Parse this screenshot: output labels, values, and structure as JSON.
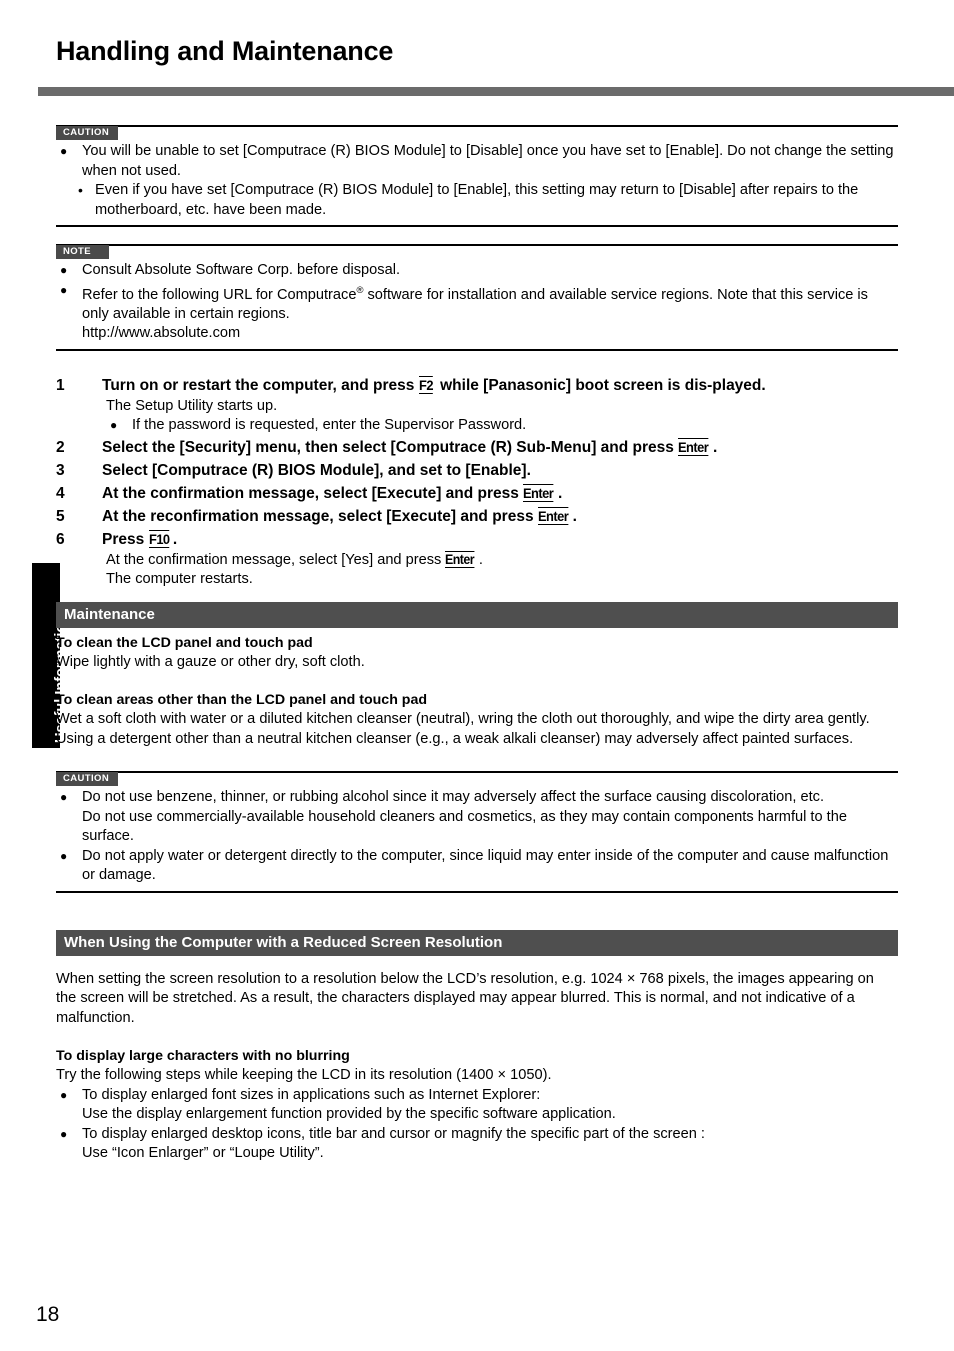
{
  "document": {
    "title": "Handling and Maintenance",
    "page_number": "18",
    "side_tab_label": "Useful Information"
  },
  "caution1": {
    "tag": "CAUTION",
    "bullets": [
      "You will be unable to set [Computrace (R) BIOS Module] to [Disable] once you have set to [Enable]. Do not change the setting when not used."
    ],
    "subbullets": [
      "Even if you have set [Computrace (R) BIOS Module] to [Enable], this setting may return to [Disable] after repairs to the motherboard, etc. have been made."
    ]
  },
  "note1": {
    "tag": "NOTE",
    "bullet1": "Consult Absolute Software Corp. before disposal.",
    "bullet2_part1": "Refer to the following URL for Computrace",
    "bullet2_reg": "®",
    "bullet2_part2": " software for installation and available service regions. Note that this service is only available in certain regions.",
    "bullet2_url": "http://www.absolute.com"
  },
  "steps": [
    {
      "num": "1",
      "head_part1": "Turn on or restart the computer, and press ",
      "key": "F2",
      "head_part2": " while [Panasonic] boot screen is dis-played.",
      "detail_line": "The Setup Utility starts up.",
      "detail_bullet": "If the password is requested, enter the Supervisor Password."
    },
    {
      "num": "2",
      "head_part1": "Select the [Security] menu, then select [Computrace (R) Sub-Menu] and press ",
      "key": "Enter",
      "head_part2": "."
    },
    {
      "num": "3",
      "head_part1": "Select [Computrace (R) BIOS Module], and set to [Enable].",
      "key": "",
      "head_part2": ""
    },
    {
      "num": "4",
      "head_part1": "At the confirmation message, select [Execute] and press ",
      "key": "Enter",
      "head_part2": "."
    },
    {
      "num": "5",
      "head_part1": "At the reconfirmation message, select [Execute] and press ",
      "key": "Enter",
      "head_part2": "."
    },
    {
      "num": "6",
      "head_part1": "Press ",
      "key": "F10",
      "head_part2": ".",
      "detail_part1": "At the confirmation message, select [Yes] and press ",
      "detail_key": "Enter",
      "detail_part2": ".",
      "detail_line2": "The computer restarts."
    }
  ],
  "maintenance": {
    "bar_title": "Maintenance",
    "sub1_head": "To clean the LCD panel and touch pad",
    "sub1_body": "Wipe lightly with a gauze or other dry, soft cloth.",
    "sub2_head": "To clean areas other than the LCD panel and touch pad",
    "sub2_body": "Wet a soft cloth with water or a diluted kitchen cleanser (neutral), wring the cloth out thoroughly, and wipe the dirty area gently.  Using a detergent other than a neutral kitchen cleanser (e.g., a weak alkali cleanser) may adversely affect painted surfaces."
  },
  "caution2": {
    "tag": "CAUTION",
    "bullet1_line1": "Do not use benzene, thinner, or rubbing alcohol since it may adversely affect the surface causing discoloration, etc.",
    "bullet1_line2": "Do not use commercially-available household cleaners and cosmetics, as they may contain components harmful to the surface.",
    "bullet2": "Do not apply water or detergent directly to the computer, since liquid may enter inside of the computer and cause malfunction or damage."
  },
  "reduced_resolution": {
    "bar_title": "When Using the Computer with a Reduced Screen Resolution",
    "intro": "When setting the screen resolution to a resolution below the LCD’s resolution, e.g. 1024 × 768 pixels, the images appearing on the screen will be stretched. As a result, the characters displayed may appear blurred. This is normal, and not indicative of a malfunction.",
    "sub_head": "To display large characters with no blurring",
    "sub_intro": "Try the following steps while keeping the LCD in its resolution (1400 × 1050).",
    "bullet1": "To display enlarged font sizes in applications such as Internet Explorer:",
    "bullet1_sub": "Use the display enlargement function provided by the specific software application.",
    "bullet2": "To display enlarged desktop icons, title bar and cursor or magnify the specific part of the screen :",
    "bullet2_sub": "Use “Icon Enlarger” or “Loupe Utility”."
  }
}
